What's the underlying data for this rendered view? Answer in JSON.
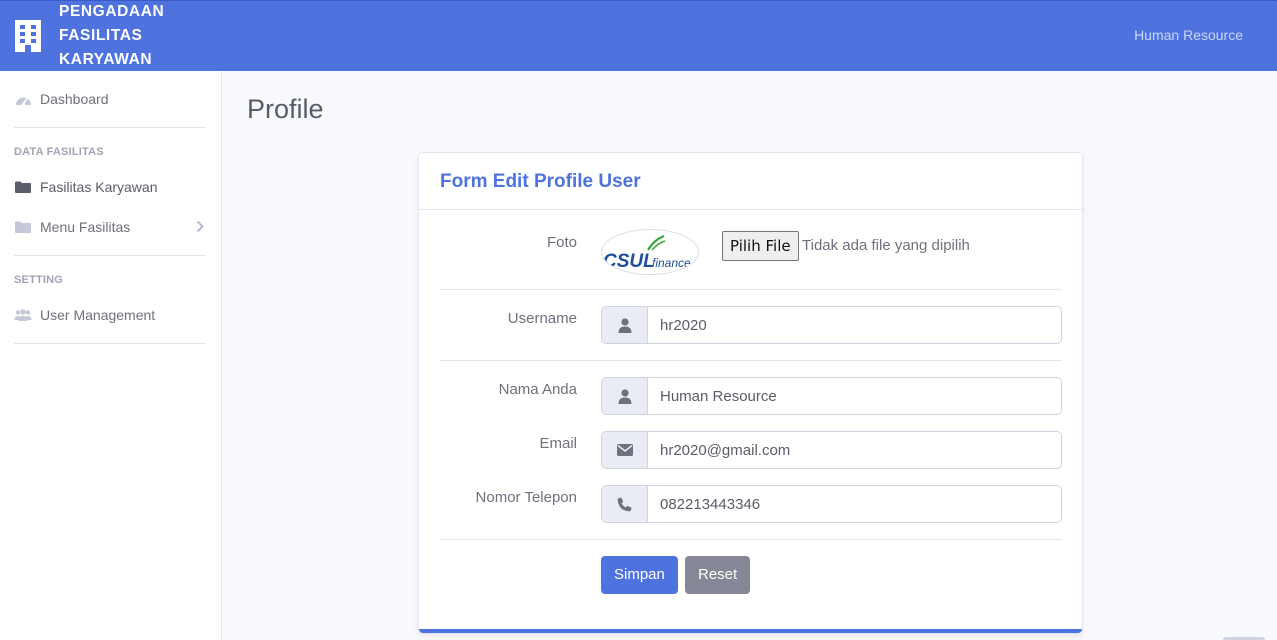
{
  "topbar": {
    "brand_lines": [
      "PENGADAAN",
      "FASILITAS",
      "KARYAWAN"
    ],
    "user_name": "Human Resource",
    "brand_icon": "building-icon",
    "color": "#4e73df"
  },
  "sidebar": {
    "dashboard": "Dashboard",
    "heading_data": "DATA FASILITAS",
    "fasilitas_karyawan": "Fasilitas Karyawan",
    "menu_fasilitas": "Menu Fasilitas",
    "heading_setting": "SETTING",
    "user_management": "User Management"
  },
  "page": {
    "title": "Profile"
  },
  "form": {
    "title": "Form Edit Profile User",
    "foto_label": "Foto",
    "file_button": "Pilih File",
    "file_status": "Tidak ada file yang dipilih",
    "username_label": "Username",
    "username_value": "hr2020",
    "nama_label": "Nama Anda",
    "nama_value": "Human Resource",
    "email_label": "Email",
    "email_value": "hr2020@gmail.com",
    "telepon_label": "Nomor Telepon",
    "telepon_value": "082213443346",
    "save_button": "Simpan",
    "reset_button": "Reset"
  },
  "logo": {
    "brand": "CSUL",
    "sub": "finance"
  }
}
